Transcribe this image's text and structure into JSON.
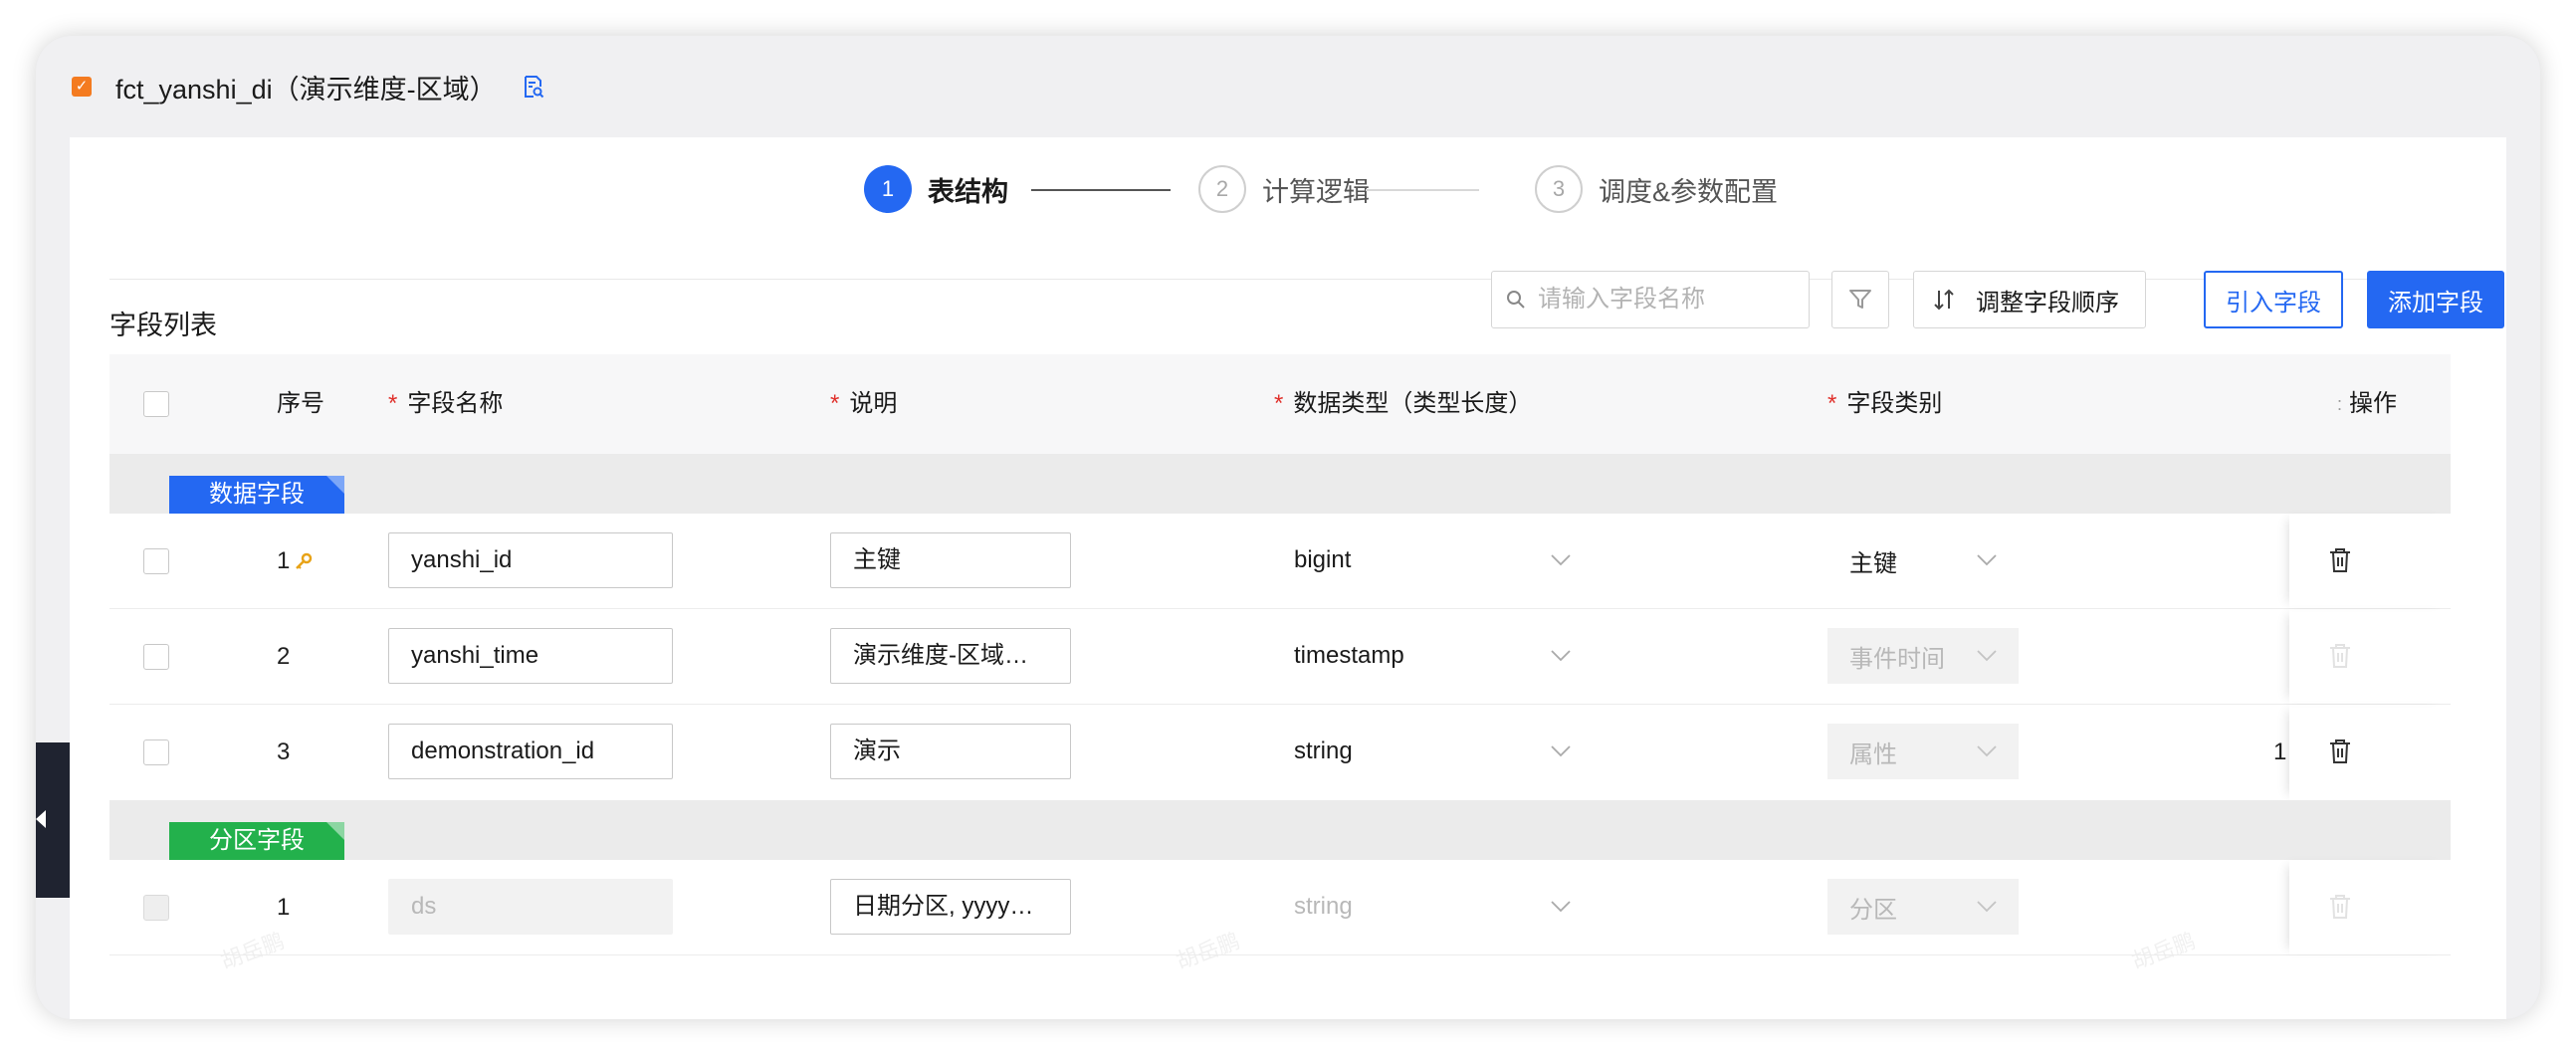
{
  "window": {
    "title": "fct_yanshi_di（演示维度-区域）"
  },
  "steps": [
    {
      "num": "1",
      "label": "表结构",
      "active": true
    },
    {
      "num": "2",
      "label": "计算逻辑",
      "active": false
    },
    {
      "num": "3",
      "label": "调度&参数配置",
      "active": false
    }
  ],
  "toolbar": {
    "section_title": "字段列表",
    "search_placeholder": "请输入字段名称",
    "sort_label": "调整字段顺序",
    "import_label": "引入字段",
    "add_label": "添加字段"
  },
  "table": {
    "headers": {
      "index": "序号",
      "name": "字段名称",
      "desc": "说明",
      "type": "数据类型（类型长度）",
      "category": "字段类别",
      "colon": ":",
      "ops": "操作"
    },
    "groups": [
      {
        "label": "数据字段",
        "color": "#2468f2",
        "rows": [
          {
            "index": "1",
            "key": true,
            "name": "yanshi_id",
            "desc": "主键",
            "type": "bigint",
            "category": "主键",
            "category_disabled": false,
            "extra": "",
            "delete_enabled": true
          },
          {
            "index": "2",
            "key": false,
            "name": "yanshi_time",
            "desc": "演示维度-区域…",
            "type": "timestamp",
            "category": "事件时间",
            "category_disabled": true,
            "extra": "",
            "delete_enabled": false
          },
          {
            "index": "3",
            "key": false,
            "name": "demonstration_id",
            "desc": "演示",
            "type": "string",
            "category": "属性",
            "category_disabled": true,
            "extra": "1",
            "delete_enabled": true
          }
        ]
      },
      {
        "label": "分区字段",
        "color": "#23b14c",
        "rows": [
          {
            "index": "1",
            "key": false,
            "name": "ds",
            "desc": "日期分区, yyyy…",
            "type": "string",
            "category": "分区",
            "category_disabled": true,
            "extra": "",
            "delete_enabled": false,
            "disabled": true
          }
        ]
      }
    ]
  },
  "watermark_text": "胡岳鹏",
  "colors": {
    "accent": "#2468f2",
    "orange": "#f47b20",
    "green": "#23b14c",
    "required": "#e0312c"
  }
}
